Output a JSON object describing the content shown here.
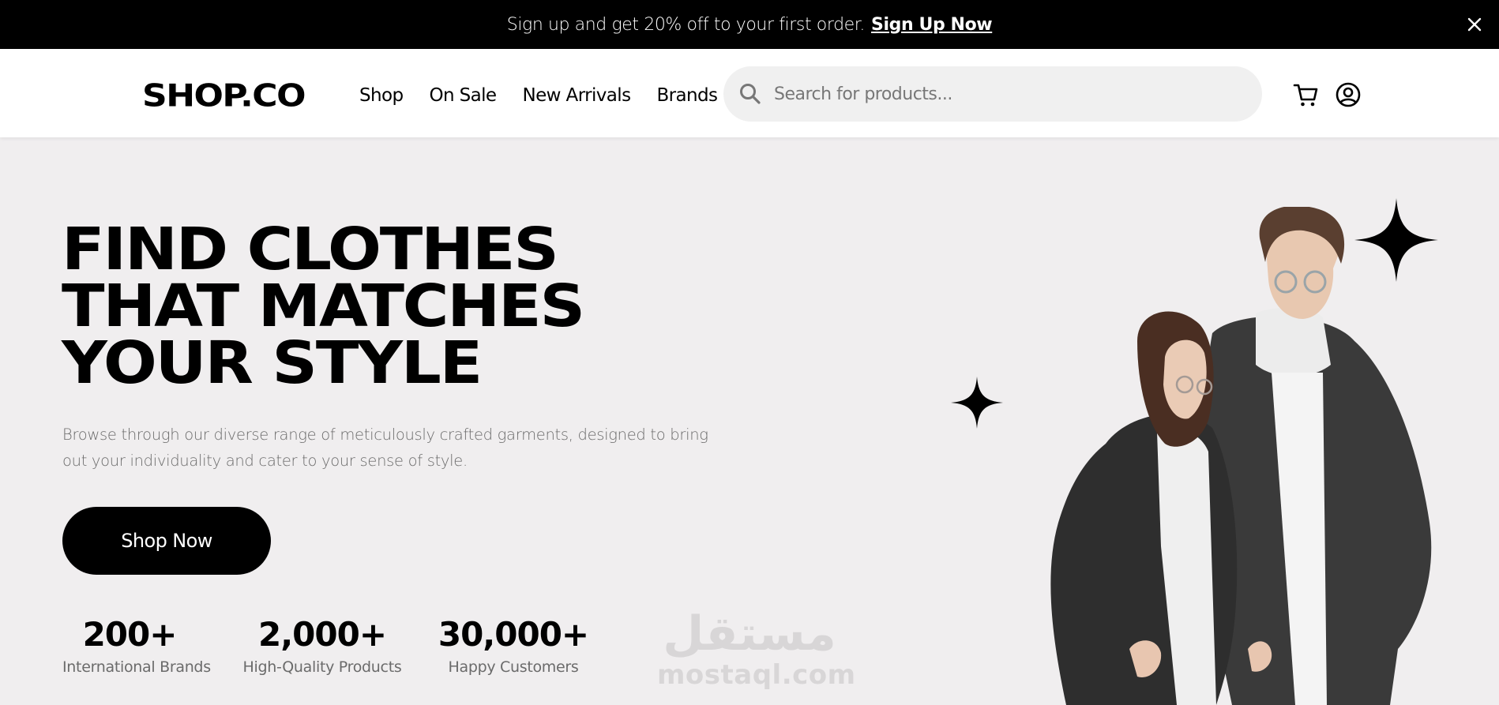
{
  "announcement": {
    "message": "Sign up and get 20% off to your first order.",
    "cta": "Sign Up Now"
  },
  "header": {
    "logo": "SHOP.CO",
    "nav": [
      "Shop",
      "On Sale",
      "New Arrivals",
      "Brands"
    ],
    "search_placeholder": "Search for products..."
  },
  "hero": {
    "title_lines": [
      "FIND CLOTHES",
      "THAT MATCHES",
      "YOUR STYLE"
    ],
    "description": "Browse through our diverse range of meticulously crafted garments, designed to bring out your individuality and cater to your sense of style.",
    "button": "Shop Now",
    "stats": [
      {
        "value": "200+",
        "label": "International Brands"
      },
      {
        "value": "2,000+",
        "label": "High-Quality Products"
      },
      {
        "value": "30,000+",
        "label": "Happy Customers"
      }
    ]
  },
  "watermark": {
    "arabic": "مستقل",
    "latin": "mostaql.com"
  },
  "icons": {
    "close": "close-icon",
    "search": "search-icon",
    "cart": "cart-icon",
    "account": "user-circle-icon",
    "sparkle": "sparkle-icon"
  },
  "colors": {
    "topbar": "#000000",
    "hero_bg": "#f0eeef",
    "button": "#000000",
    "muted_text": "#6b6b6b"
  }
}
